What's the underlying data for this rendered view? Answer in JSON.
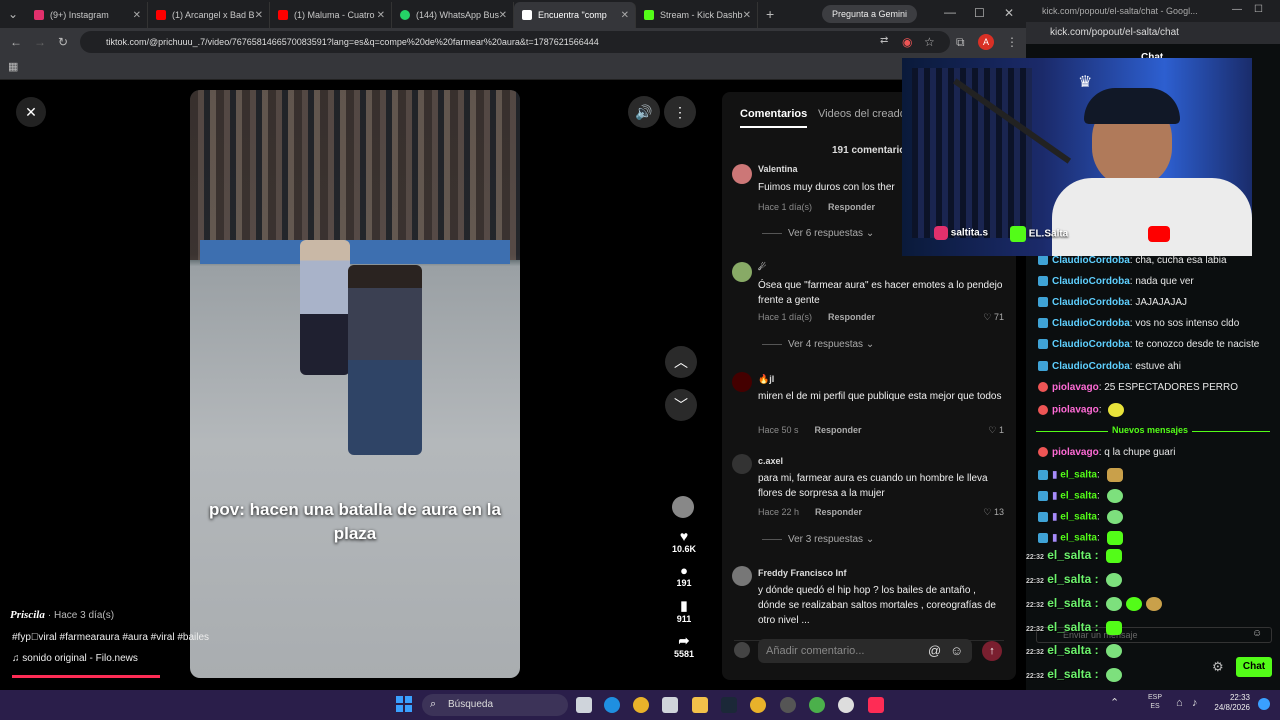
{
  "browser": {
    "tabs": [
      {
        "label": "(9+) Instagram",
        "color": "#e1306c"
      },
      {
        "label": "(1) Arcangel x Bad B",
        "color": "#ff0000"
      },
      {
        "label": "(1) Maluma - Cuatro",
        "color": "#ff0000"
      },
      {
        "label": "(144) WhatsApp Bus",
        "color": "#25d366"
      },
      {
        "label": "Encuentra \"comp",
        "color": "#ffffff"
      },
      {
        "label": "Stream - Kick Dashb",
        "color": "#53fc18"
      }
    ],
    "gemini_button": "Pregunta a Gemini",
    "url": "tiktok.com/@prichuuu_.7/video/7676581466570083591?lang=es&q=compe%20de%20farmear%20aura&t=1787621566444",
    "profile_initial": "A"
  },
  "video": {
    "caption": "pov: hacen una batalla de aura en la plaza",
    "author": "Priscila",
    "author_time": "· Hace 3 día(s)",
    "tags": "#fyp゚viral #farmearaura #aura #viral #bailes",
    "sound": "sonido original - Filo.news",
    "likes": "10.6K",
    "comments_count": "191",
    "saves": "911",
    "shares": "5581"
  },
  "comments_panel": {
    "tab_active": "Comentarios",
    "tab_other": "Videos del creado",
    "total": "191 comentarios",
    "items": [
      {
        "name": "Valentina",
        "text": "Fuimos muy duros con los ther",
        "time": "Hace 1 día(s)",
        "reply": "Responder",
        "likes": "",
        "more": "Ver 6 respuestas ⌄"
      },
      {
        "name": "☄",
        "text": "Ósea que \"farmear aura\" es hacer emotes a lo pendejo frente a gente",
        "time": "Hace 1 día(s)",
        "reply": "Responder",
        "likes": "♡ 71",
        "more": "Ver 4 respuestas ⌄"
      },
      {
        "name": "🔥jl",
        "text": "miren el de mi perfil que publique esta mejor que todos",
        "time": "Hace 50 s",
        "reply": "Responder",
        "likes": "♡ 1",
        "more": ""
      },
      {
        "name": "c.axel",
        "text": "para mi, farmear aura es cuando un hombre le lleva flores de sorpresa a la mujer",
        "time": "Hace 22 h",
        "reply": "Responder",
        "likes": "♡ 13",
        "more": "Ver 3 respuestas ⌄"
      },
      {
        "name": "Freddy Francisco Inf",
        "text": "y dónde quedó el hip hop ? los bailes de antaño , dónde se realizaban saltos mortales , coreografías de otro nivel ...",
        "time": "",
        "reply": "",
        "likes": "",
        "more": ""
      }
    ],
    "input_placeholder": "Añadir comentario..."
  },
  "kick": {
    "window_title": "kick.com/popout/el-salta/chat - Googl...",
    "url": "kick.com/popout/el-salta/chat",
    "header": "Chat",
    "messages": [
      {
        "user": "ClaudioCordoba",
        "text": "cha, cucha esa labia",
        "color": "#5fd0ff"
      },
      {
        "user": "ClaudioCordoba",
        "text": "nada que ver",
        "color": "#5fd0ff"
      },
      {
        "user": "ClaudioCordoba",
        "text": "JAJAJAJAJ",
        "color": "#5fd0ff"
      },
      {
        "user": "ClaudioCordoba",
        "text": "vos no sos intenso cldo",
        "color": "#5fd0ff"
      },
      {
        "user": "ClaudioCordoba",
        "text": "te conozco desde te naciste",
        "color": "#5fd0ff"
      },
      {
        "user": "ClaudioCordoba",
        "text": "estuve ahi",
        "color": "#5fd0ff"
      },
      {
        "user": "piolavago",
        "text": "25 ESPECTADORES PERRO",
        "color": "#ff6bd6"
      },
      {
        "user": "piolavago",
        "text": "",
        "color": "#ff6bd6"
      }
    ],
    "new_messages": "Nuevos mensajes",
    "after": [
      {
        "user": "piolavago",
        "text": "q la chupe guari",
        "color": "#ff6bd6"
      },
      {
        "user": "el_salta",
        "text": "",
        "color": "#53fc18"
      },
      {
        "user": "el_salta",
        "text": "",
        "color": "#53fc18"
      },
      {
        "user": "el_salta",
        "text": "",
        "color": "#53fc18"
      },
      {
        "user": "el_salta",
        "text": "",
        "color": "#53fc18"
      }
    ],
    "overlay": [
      {
        "time": "22:32",
        "user": "el_salta :"
      },
      {
        "time": "22:32",
        "user": "el_salta :"
      },
      {
        "time": "22:32",
        "user": "el_salta :"
      },
      {
        "time": "22:32",
        "user": "el_salta :"
      },
      {
        "time": "22:32",
        "user": "el_salta :"
      },
      {
        "time": "22:32",
        "user": "el_salta :"
      }
    ],
    "send_placeholder": "Enviar un mensaje",
    "chat_button": "Chat",
    "webcam_ig": "saltita.s",
    "webcam_kick": "EL.Salta"
  },
  "taskbar": {
    "search": "Búsqueda",
    "lang": "ESP",
    "lang2": "ES",
    "time": "22:33",
    "date": "24/8/2026"
  }
}
